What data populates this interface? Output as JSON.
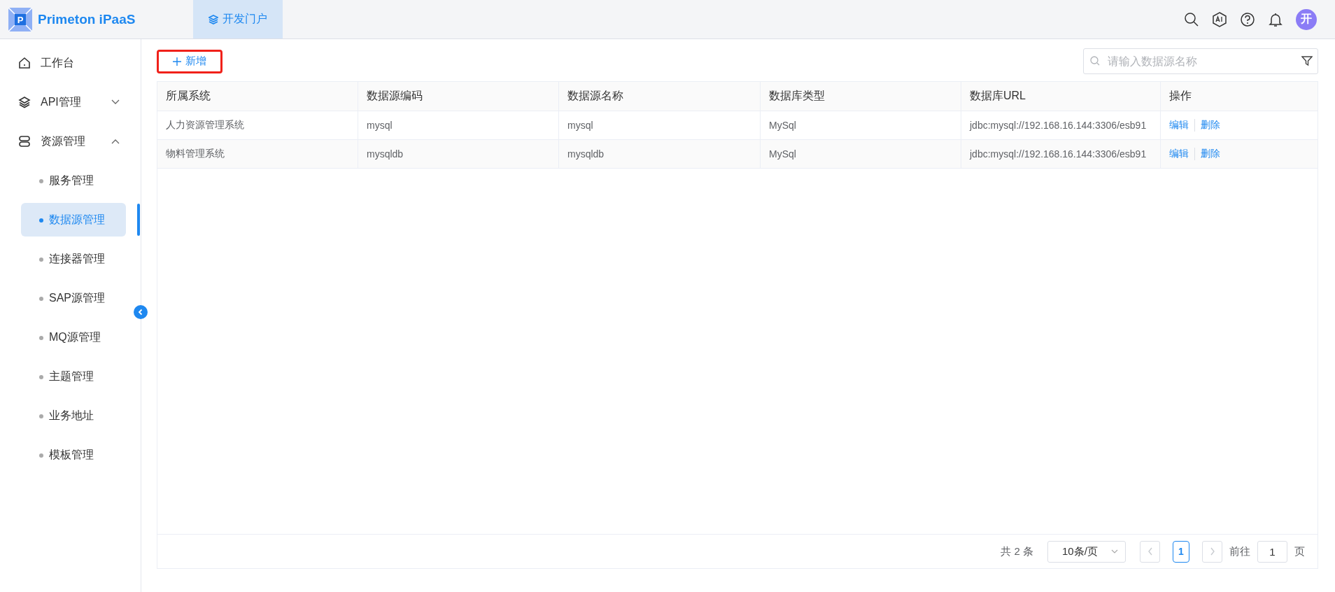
{
  "header": {
    "logo_mark": "P",
    "logo_text": "Primeton iPaaS",
    "nav_tabs": [
      {
        "label": "开发门户",
        "selected": true
      }
    ],
    "avatar_text": "开"
  },
  "sidebar": {
    "items": [
      {
        "kind": "top",
        "label": "工作台"
      },
      {
        "kind": "group",
        "label": "API管理",
        "expanded": false
      },
      {
        "kind": "group",
        "label": "资源管理",
        "expanded": true,
        "children": [
          {
            "label": "服务管理",
            "selected": false
          },
          {
            "label": "数据源管理",
            "selected": true
          },
          {
            "label": "连接器管理",
            "selected": false
          },
          {
            "label": "SAP源管理",
            "selected": false
          },
          {
            "label": "MQ源管理",
            "selected": false
          },
          {
            "label": "主题管理",
            "selected": false
          },
          {
            "label": "业务地址",
            "selected": false
          },
          {
            "label": "模板管理",
            "selected": false
          }
        ]
      }
    ]
  },
  "toolbar": {
    "add_button": {
      "label": "新增",
      "highlighted": true
    },
    "search": {
      "placeholder": "请输入数据源名称"
    }
  },
  "table": {
    "columns": [
      "所属系统",
      "数据源编码",
      "数据源名称",
      "数据库类型",
      "数据库URL",
      "操作"
    ],
    "rows": [
      {
        "cells": [
          "人力资源管理系统",
          "mysql",
          "mysql",
          "MySql",
          "jdbc:mysql://192.168.16.144:3306/esb91"
        ],
        "actions": [
          "编辑",
          "删除"
        ]
      },
      {
        "cells": [
          "物料管理系统",
          "mysqldb",
          "mysqldb",
          "MySql",
          "jdbc:mysql://192.168.16.144:3306/esb91"
        ],
        "actions": [
          "编辑",
          "删除"
        ]
      }
    ]
  },
  "pagination": {
    "total": "共 2 条",
    "page_size": "10条/页",
    "prev_disabled": true,
    "next_disabled": true,
    "pages": [
      {
        "label": "1",
        "selected": true
      }
    ],
    "goto_label": "前往",
    "goto_value": "1",
    "page_suffix": "页"
  }
}
